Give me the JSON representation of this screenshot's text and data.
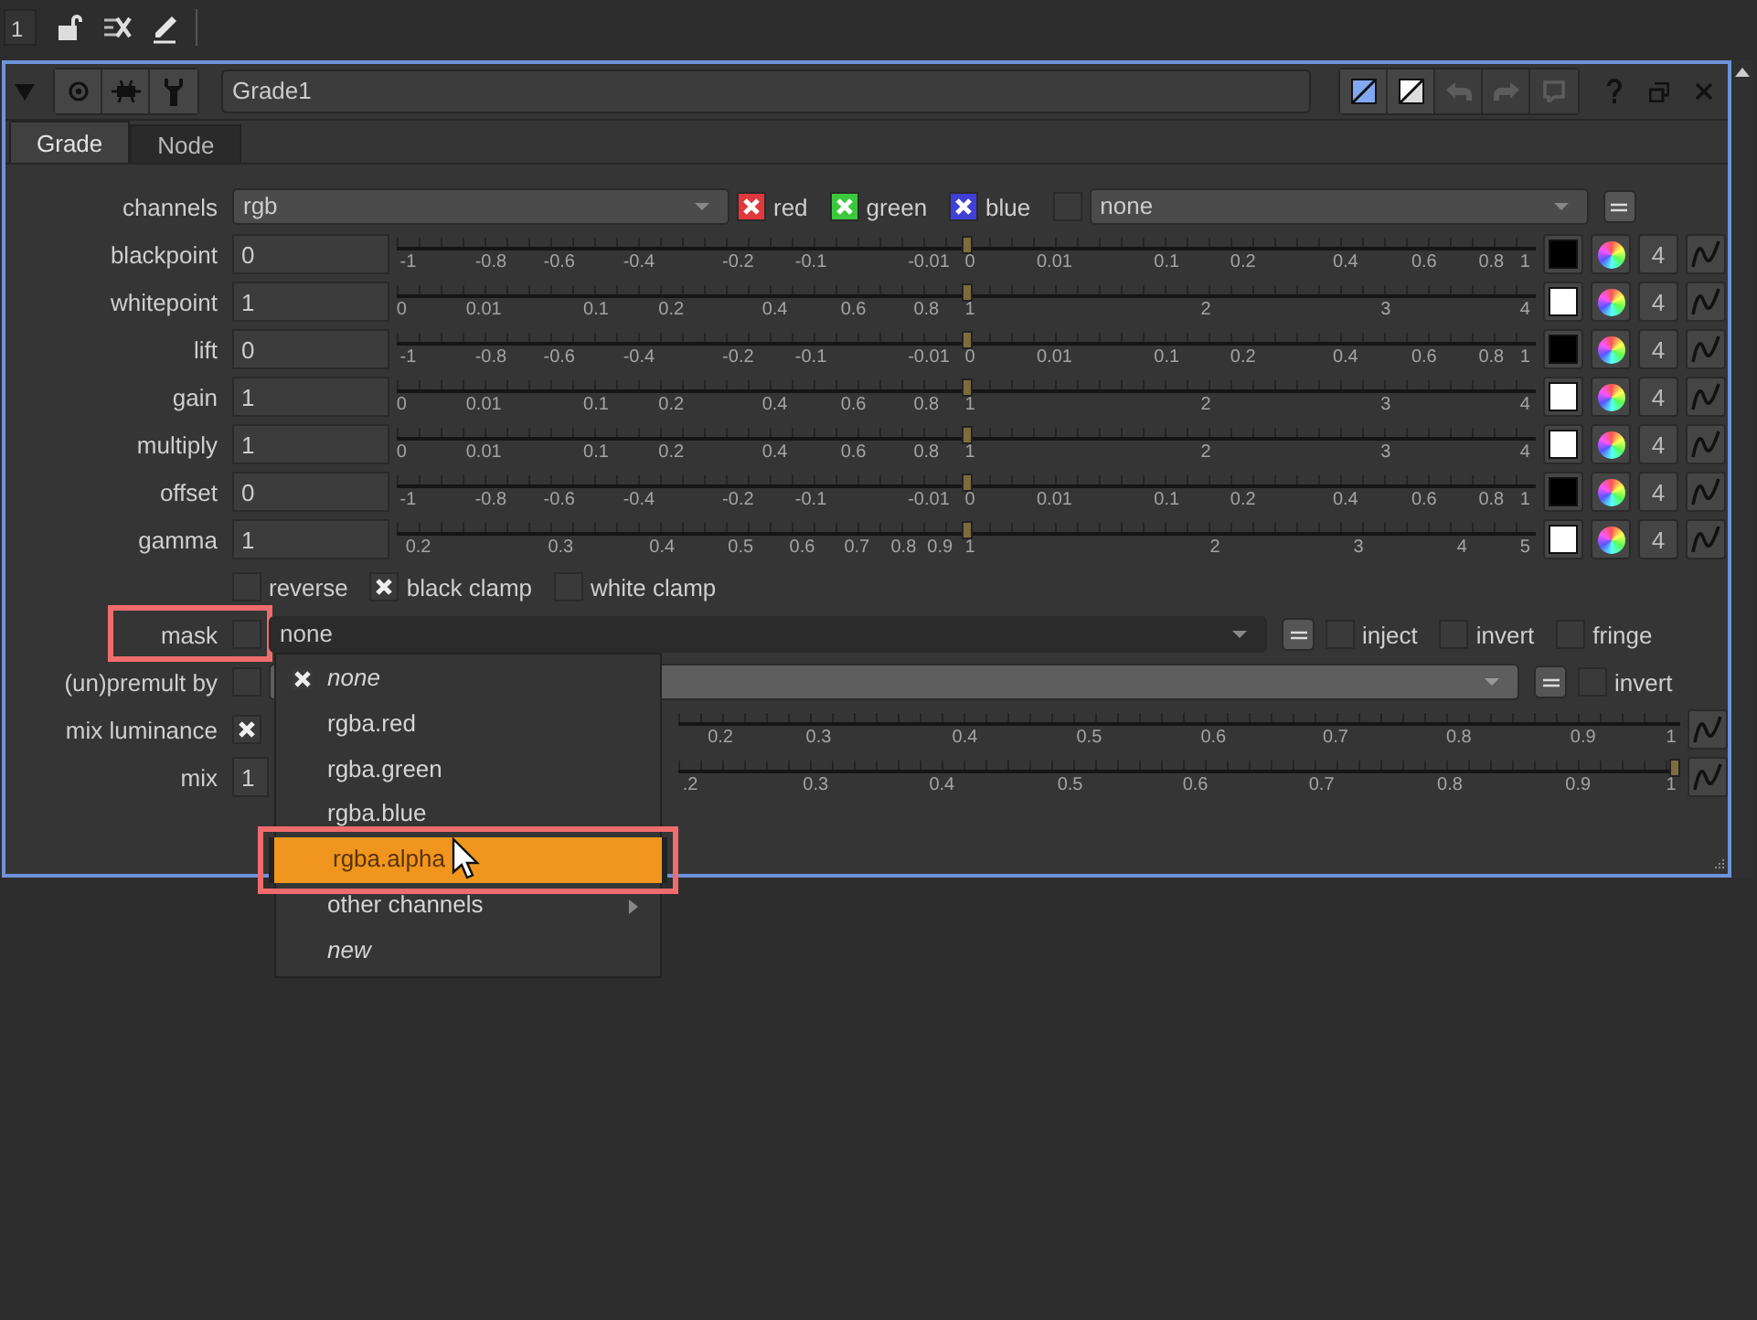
{
  "toolbar": {
    "counter": "1"
  },
  "panel": {
    "name": "Grade1",
    "buttons": [
      {
        "kind": "view-a",
        "disabled": false
      },
      {
        "kind": "view-b",
        "disabled": false
      },
      {
        "kind": "undo",
        "disabled": true
      },
      {
        "kind": "redo",
        "disabled": true
      },
      {
        "kind": "revert",
        "disabled": true
      }
    ]
  },
  "tabs": [
    {
      "label": "Grade",
      "selected": true
    },
    {
      "label": "Node",
      "selected": false
    }
  ],
  "channels": {
    "label": "channels",
    "value": "rgb",
    "toggles": [
      {
        "label": "red",
        "checked": true,
        "color": "#e0383c"
      },
      {
        "label": "green",
        "checked": true,
        "color": "#3cc83c"
      },
      {
        "label": "blue",
        "checked": true,
        "color": "#4040d8"
      }
    ],
    "extra_checked": false,
    "extra_value": "none"
  },
  "knobs": [
    {
      "label": "blackpoint",
      "value": "0",
      "level": 0.5,
      "color": "#000000",
      "count": "4",
      "ticks": [
        "-1",
        "-0.8",
        "-0.6",
        "-0.4",
        "-0.2",
        "-0.1",
        "-0.01",
        "0",
        "0.01",
        "0.1",
        "0.2",
        "0.4",
        "0.6",
        "0.8",
        "1"
      ]
    },
    {
      "label": "whitepoint",
      "value": "1",
      "level": 0.5,
      "color": "#ffffff",
      "count": "4",
      "ticks": [
        "0",
        "0.01",
        "0.1",
        "0.2",
        "0.4",
        "0.6",
        "0.8",
        "1",
        "2",
        "3",
        "4"
      ]
    },
    {
      "label": "lift",
      "value": "0",
      "level": 0.5,
      "color": "#000000",
      "count": "4",
      "ticks": [
        "-1",
        "-0.8",
        "-0.6",
        "-0.4",
        "-0.2",
        "-0.1",
        "-0.01",
        "0",
        "0.01",
        "0.1",
        "0.2",
        "0.4",
        "0.6",
        "0.8",
        "1"
      ]
    },
    {
      "label": "gain",
      "value": "1",
      "level": 0.5,
      "color": "#ffffff",
      "count": "4",
      "ticks": [
        "0",
        "0.01",
        "0.1",
        "0.2",
        "0.4",
        "0.6",
        "0.8",
        "1",
        "2",
        "3",
        "4"
      ]
    },
    {
      "label": "multiply",
      "value": "1",
      "level": 0.5,
      "color": "#ffffff",
      "count": "4",
      "ticks": [
        "0",
        "0.01",
        "0.1",
        "0.2",
        "0.4",
        "0.6",
        "0.8",
        "1",
        "2",
        "3",
        "4"
      ]
    },
    {
      "label": "offset",
      "value": "0",
      "level": 0.5,
      "color": "#000000",
      "count": "4",
      "ticks": [
        "-1",
        "-0.8",
        "-0.6",
        "-0.4",
        "-0.2",
        "-0.1",
        "-0.01",
        "0",
        "0.01",
        "0.1",
        "0.2",
        "0.4",
        "0.6",
        "0.8",
        "1"
      ]
    },
    {
      "label": "gamma",
      "value": "1",
      "level": 0.5,
      "color": "#ffffff",
      "count": "4",
      "ticks": [
        "0.2",
        "0.3",
        "0.4",
        "0.5",
        "0.6",
        "0.7",
        "0.8",
        "0.9",
        "1",
        "2",
        "3",
        "4",
        "5"
      ]
    }
  ],
  "clamps": [
    {
      "label": "reverse",
      "checked": false
    },
    {
      "label": "black clamp",
      "checked": true
    },
    {
      "label": "white clamp",
      "checked": false
    }
  ],
  "mask": {
    "label": "mask",
    "checked": false,
    "outlined": true,
    "value": "none",
    "options": [
      {
        "label": "inject",
        "checked": false
      },
      {
        "label": "invert",
        "checked": false
      },
      {
        "label": "fringe",
        "checked": false
      }
    ]
  },
  "premult": {
    "label": "(un)premult by",
    "checked": false,
    "options": [
      {
        "label": "invert",
        "checked": false
      }
    ]
  },
  "mix_luminance": {
    "label": "mix luminance",
    "checked": true,
    "ticks": [
      "0.2",
      "0.3",
      "0.4",
      "0.5",
      "0.6",
      "0.7",
      "0.8",
      "0.9",
      "1"
    ]
  },
  "mix": {
    "label": "mix",
    "value": "1",
    "level": 1,
    "ticks": [
      ".2",
      "0.3",
      "0.4",
      "0.5",
      "0.6",
      "0.7",
      "0.8",
      "0.9",
      "1"
    ]
  },
  "menu": [
    {
      "label": "none",
      "kind": "special",
      "checked": true,
      "highlighted": false
    },
    {
      "label": "rgba.red",
      "kind": "channel",
      "checked": false,
      "highlighted": false
    },
    {
      "label": "rgba.green",
      "kind": "channel",
      "checked": false,
      "highlighted": false
    },
    {
      "label": "rgba.blue",
      "kind": "channel",
      "checked": false,
      "highlighted": false
    },
    {
      "label": "rgba.alpha",
      "kind": "channel",
      "checked": false,
      "highlighted": true
    },
    {
      "label": "other channels",
      "kind": "submenu",
      "checked": false,
      "highlighted": false
    },
    {
      "label": "new",
      "kind": "special",
      "checked": false,
      "highlighted": false
    }
  ]
}
